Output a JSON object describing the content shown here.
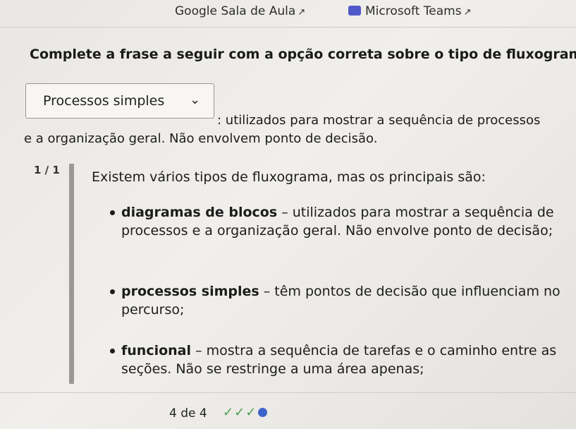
{
  "top_links": {
    "classroom_label": "Google Sala de Aula",
    "teams_label": "Microsoft Teams"
  },
  "question": "Complete a frase a seguir com a opção correta sobre o tipo de fluxograma:",
  "dropdown": {
    "selected": "Processos simples"
  },
  "statement": {
    "line1": ": utilizados para mostrar a sequência de processos",
    "line2": "e a organização geral. Não envolvem ponto de decisão."
  },
  "feedback": {
    "score": "1 / 1",
    "intro": "Existem vários tipos de fluxograma, mas os principais são:",
    "items": [
      {
        "term": "diagramas de blocos",
        "desc": " – utilizados para mostrar a sequência de processos e a organização geral. Não envolve ponto de decisão;"
      },
      {
        "term": "processos simples",
        "desc": " – têm pontos de decisão que influenciam no percurso;"
      },
      {
        "term": "funcional",
        "desc": " – mostra a sequência de tarefas e o caminho entre as seções. Não se restringe a uma área apenas;"
      }
    ]
  },
  "progress": {
    "label": "4 de 4",
    "completed": 3,
    "total": 4,
    "check_color": "#4a9d4f",
    "current_color": "#3d63c9"
  }
}
